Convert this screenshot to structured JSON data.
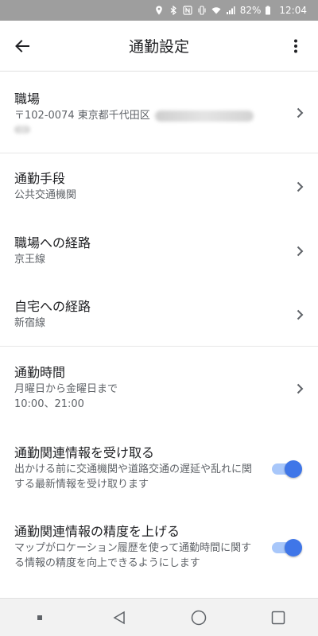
{
  "status_bar": {
    "battery": "82%",
    "time": "12:04",
    "icons": [
      "location-icon",
      "bluetooth-icon",
      "nfc-icon",
      "vibrate-icon",
      "wifi-icon",
      "signal-icon",
      "battery-icon"
    ]
  },
  "app_bar": {
    "title": "通勤設定",
    "back_icon": "arrow-back-icon",
    "menu_icon": "more-vert-icon"
  },
  "items": {
    "workplace": {
      "title": "職場",
      "subtitle": "〒102-0074 東京都千代田区"
    },
    "mode": {
      "title": "通勤手段",
      "subtitle": "公共交通機関"
    },
    "route_work": {
      "title": "職場への経路",
      "subtitle": "京王線"
    },
    "route_home": {
      "title": "自宅への経路",
      "subtitle": "新宿線"
    },
    "time": {
      "title": "通勤時間",
      "subtitle1": "月曜日から金曜日まで",
      "subtitle2": "10:00、21:00"
    }
  },
  "toggles": {
    "receive": {
      "title": "通勤関連情報を受け取る",
      "desc": "出かける前に交通機関や道路交通の遅延や乱れに関する最新情報を受け取ります",
      "on": true
    },
    "accuracy": {
      "title": "通勤関連情報の精度を上げる",
      "desc": "マップがロケーション履歴を使って通勤時間に関する情報の精度を向上できるようにします",
      "on": true
    }
  },
  "colors": {
    "accent": "#3f76e8",
    "accent_track": "#a8c7fa",
    "status_bar": "#9e9e9e"
  },
  "nav_bar": [
    "square-dot-icon",
    "back-triangle-icon",
    "home-circle-icon",
    "recents-square-icon"
  ]
}
